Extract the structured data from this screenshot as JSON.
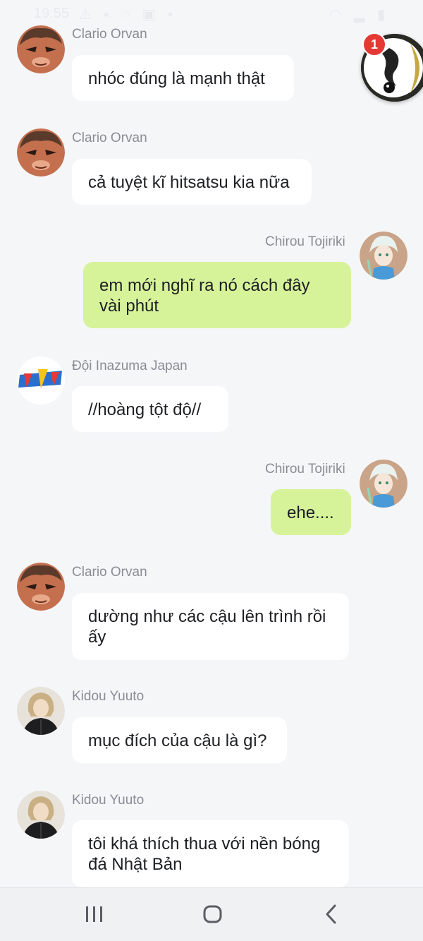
{
  "status": {
    "time": "19:55",
    "left_icons": [
      "warning-icon",
      "chat-icon",
      "check-icon",
      "app-icon",
      "dot-icon"
    ],
    "right_icons": [
      "wifi-icon",
      "signal-icon",
      "battery-icon"
    ]
  },
  "floating_bubble": {
    "badge_count": "1"
  },
  "messages": [
    {
      "sender": "Clario Orvan",
      "text": "nhóc đúng là mạnh thật",
      "mine": false,
      "avatar": "clario-avatar"
    },
    {
      "sender": "Clario Orvan",
      "text": "cả tuyệt kĩ hitsatsu kia nữa",
      "mine": false,
      "avatar": "clario-avatar"
    },
    {
      "sender": "Chirou Tojiriki",
      "text": "em mới nghĩ ra nó cách đây vài phút",
      "mine": true,
      "avatar": "chirou-avatar"
    },
    {
      "sender": "Đội Inazuma Japan",
      "text": "//hoàng tột độ//",
      "mine": false,
      "avatar": "inazuma-avatar"
    },
    {
      "sender": "Chirou Tojiriki",
      "text": "ehe....",
      "mine": true,
      "avatar": "chirou-avatar"
    },
    {
      "sender": "Clario Orvan",
      "text": "dường như các cậu lên trình rồi ấy",
      "mine": false,
      "avatar": "clario-avatar"
    },
    {
      "sender": "Kidou Yuuto",
      "text": "mục đích của cậu là gì?",
      "mine": false,
      "avatar": "kidou-avatar"
    },
    {
      "sender": "Kidou Yuuto",
      "text": "tôi khá thích thua với nền bóng đá Nhật Bản",
      "mine": false,
      "avatar": "kidou-avatar"
    }
  ],
  "navbar": {
    "buttons": [
      "recent-apps-icon",
      "home-icon",
      "back-icon"
    ]
  }
}
